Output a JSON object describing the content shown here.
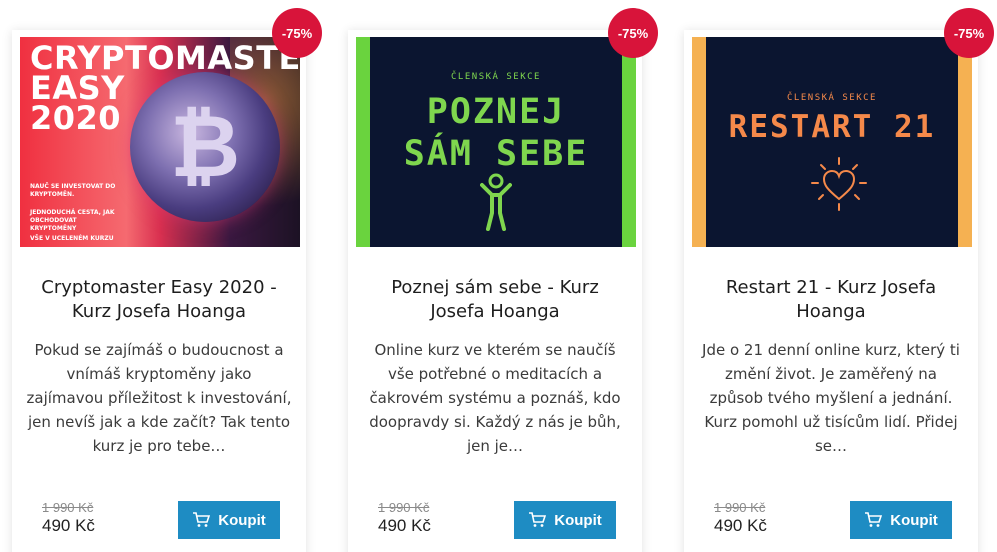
{
  "products": [
    {
      "badge": "-75%",
      "thumb_title": "CRYPTOMASTER\nEASY\n2020",
      "thumb_line1": "NAUČ SE INVESTOVAT DO KRYPTOMĚN.",
      "thumb_line2": "JEDNODUCHÁ CESTA, JAK OBCHODOVAT KRYPTOMĚNY",
      "thumb_line3": "VŠE V UCELENÉM KURZU",
      "coin_glyph": "₿",
      "title": "Cryptomaster Easy 2020 - Kurz Josefa Hoanga",
      "description": "Pokud se zajímáš o budoucnost a vnímáš kryptoměny jako zajímavou příležitost k investování, jen nevíš jak a kde začít? Tak tento kurz je pro tebe…",
      "old_price": "1 990 Kč",
      "price": "490 Kč",
      "buy_label": "Koupit"
    },
    {
      "badge": "-75%",
      "thumb_section": "ČLENSKÁ SEKCE",
      "thumb_title": "POZNEJ\nSÁM SEBE",
      "title": "Poznej sám sebe - Kurz Josefa Hoanga",
      "description": "Online kurz ve kterém se naučíš vše potřebné o meditacích a čakrovém systému a poznáš, kdo doopravdy si. Každý z nás je bůh, jen je…",
      "old_price": "1 990 Kč",
      "price": "490 Kč",
      "buy_label": "Koupit"
    },
    {
      "badge": "-75%",
      "thumb_section": "ČLENSKÁ SEKCE",
      "thumb_title": "RESTART 21",
      "title": "Restart 21 - Kurz Josefa Hoanga",
      "description": "Jde o 21 denní online kurz, který ti změní život. Je zaměřený na způsob tvého myšlení a jednání. Kurz pomohl už tisícům lidí. Přidej se…",
      "old_price": "1 990 Kč",
      "price": "490 Kč",
      "buy_label": "Koupit"
    }
  ],
  "colors": {
    "badge": "#d8143a",
    "button": "#1e8cc3",
    "green_accent": "#6ad33e",
    "orange_accent": "#f5894a",
    "thumb_dark": "#0b1530"
  },
  "icons": {
    "cart": "cart-icon",
    "person": "person-icon",
    "heart": "heart-icon"
  }
}
